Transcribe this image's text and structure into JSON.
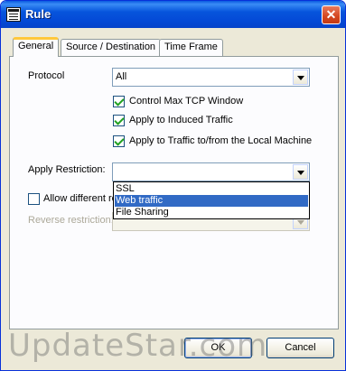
{
  "window": {
    "title": "Rule",
    "close_glyph": "✕"
  },
  "tabs": [
    {
      "label": "General",
      "active": true
    },
    {
      "label": "Source / Destination",
      "active": false
    },
    {
      "label": "Time Frame",
      "active": false
    }
  ],
  "general": {
    "protocol_label": "Protocol",
    "protocol_value": "All",
    "checkboxes": [
      {
        "label": "Control Max TCP Window",
        "checked": true
      },
      {
        "label": "Apply to Induced Traffic",
        "checked": true
      },
      {
        "label": "Apply to Traffic to/from the Local Machine",
        "checked": true
      }
    ],
    "apply_restriction_label": "Apply Restriction:",
    "apply_restriction_value": "",
    "apply_restriction_options": [
      {
        "label": "SSL",
        "selected": false
      },
      {
        "label": "Web traffic",
        "selected": true
      },
      {
        "label": "File Sharing",
        "selected": false
      }
    ],
    "allow_different_label": "Allow different re",
    "allow_different_checked": false,
    "reverse_restriction_label": "Reverse restriction:",
    "reverse_restriction_value": ""
  },
  "buttons": {
    "ok": "OK",
    "cancel": "Cancel"
  },
  "watermark": "UpdateStar.com",
  "colors": {
    "titlebar": "#0755dc",
    "selection": "#316ac5",
    "tab_highlight": "#ffc83c"
  }
}
